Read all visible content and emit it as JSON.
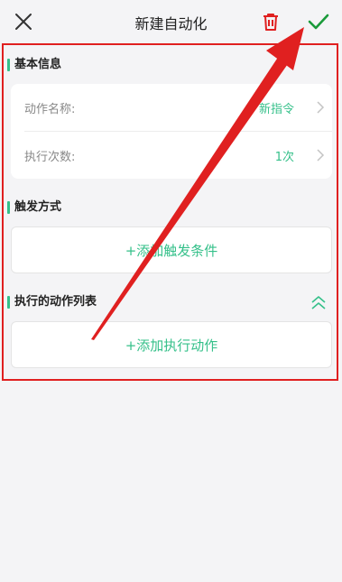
{
  "header": {
    "title": "新建自动化"
  },
  "basic_info": {
    "section_title": "基本信息",
    "rows": [
      {
        "label": "动作名称:",
        "value": "新指令"
      },
      {
        "label": "执行次数:",
        "value": "1次"
      }
    ]
  },
  "trigger": {
    "section_title": "触发方式",
    "add_label": "+添加触发条件"
  },
  "actions": {
    "section_title": "执行的动作列表",
    "add_label": "+添加执行动作"
  },
  "colors": {
    "accent_green": "#35c08a",
    "delete_red": "#e02020",
    "annotation_red": "#e02020",
    "background": "#f4f4f6"
  },
  "icons": [
    "close-icon",
    "trash-icon",
    "check-icon",
    "chevron-right-icon",
    "double-chevron-up-icon"
  ]
}
